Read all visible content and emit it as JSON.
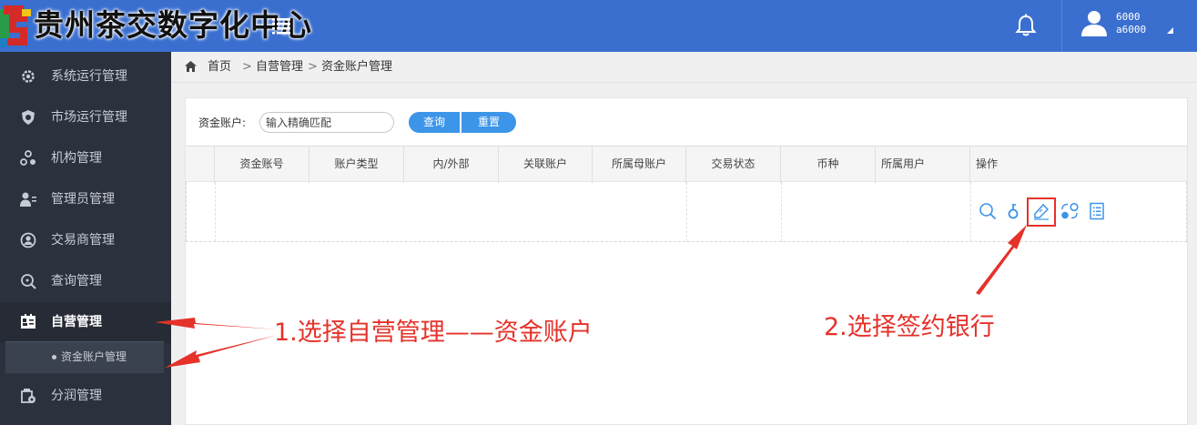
{
  "header": {
    "logo_text": "贵州茶交数字化中心",
    "user_name": "6000",
    "user_id": "a6000"
  },
  "sidebar": {
    "items": [
      {
        "label": "系统运行管理",
        "icon": "gear-icon"
      },
      {
        "label": "市场运行管理",
        "icon": "shield-icon"
      },
      {
        "label": "机构管理",
        "icon": "org-icon"
      },
      {
        "label": "管理员管理",
        "icon": "admin-icon"
      },
      {
        "label": "交易商管理",
        "icon": "user-circle-icon"
      },
      {
        "label": "查询管理",
        "icon": "search-icon"
      },
      {
        "label": "自营管理",
        "icon": "id-card-icon",
        "active": true
      },
      {
        "label": "分润管理",
        "icon": "wallet-icon"
      }
    ],
    "sub_item": "资金账户管理"
  },
  "breadcrumb": {
    "home": "首页",
    "sep": ">",
    "level1": "自营管理",
    "level2": "资金账户管理"
  },
  "search": {
    "label": "资金账户:",
    "placeholder": "输入精确匹配",
    "query_label": "查询",
    "reset_label": "重置"
  },
  "table": {
    "columns": [
      "资金账号",
      "账户类型",
      "内/外部",
      "关联账户",
      "所属母账户",
      "交易状态",
      "币种",
      "所属用户",
      "操作"
    ],
    "actions": [
      "search-icon",
      "key-icon",
      "sign-bank-icon",
      "transfer-icon",
      "list-icon"
    ]
  },
  "annotations": {
    "step1": "1.选择自营管理——资金账户",
    "step2": "2.选择签约银行"
  },
  "colors": {
    "header_bg": "#3a6fd0",
    "sidebar_bg": "#2b313d",
    "button_blue": "#3c95e8",
    "annotation_red": "#e5322a"
  }
}
